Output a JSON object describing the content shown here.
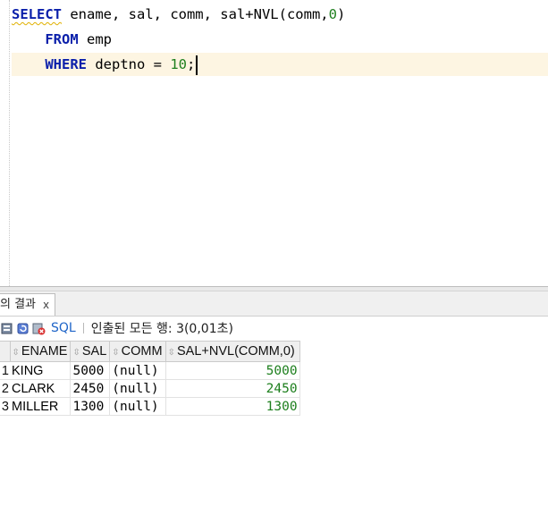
{
  "editor": {
    "line1": {
      "keyword": "SELECT",
      "rest_a": " ename, sal, comm, sal+NVL(comm,",
      "num": "0",
      "rest_b": ")"
    },
    "line2": {
      "indent": "    ",
      "keyword": "FROM",
      "rest": " emp"
    },
    "line3": {
      "indent": "    ",
      "keyword": "WHERE",
      "rest": " deptno = ",
      "num": "10",
      "end": ";"
    }
  },
  "results_tab": {
    "label": "의 결과",
    "close": "x"
  },
  "toolbar": {
    "icons": [
      "pin-icon",
      "refresh-icon",
      "cancel-query-icon"
    ],
    "sql_label": "SQL",
    "status": "인출된 모든 행: 3(0,01초)"
  },
  "grid": {
    "columns": [
      "ENAME",
      "SAL",
      "COMM",
      "SAL+NVL(COMM,0)"
    ],
    "rows": [
      {
        "n": "1",
        "ename": "KING",
        "sal": "5000",
        "comm": "(null)",
        "total": "5000"
      },
      {
        "n": "2",
        "ename": "CLARK",
        "sal": "2450",
        "comm": "(null)",
        "total": "2450"
      },
      {
        "n": "3",
        "ename": "MILLER",
        "sal": "1300",
        "comm": "(null)",
        "total": "1300"
      }
    ]
  },
  "colors": {
    "keyword": "#0a1faa",
    "number": "#1d7f1d",
    "current_line": "#fdf5e2",
    "link": "#1e64c8"
  }
}
